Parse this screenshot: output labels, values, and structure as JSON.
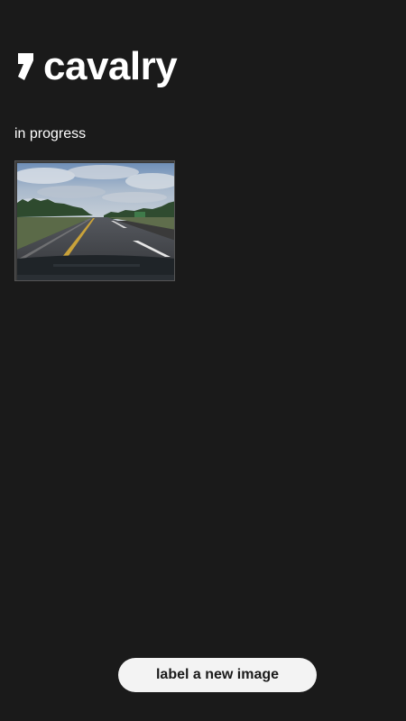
{
  "app": {
    "brand_name": "cavalry",
    "logo_icon": "comma-logo-icon"
  },
  "in_progress": {
    "heading": "in progress",
    "items": [
      {
        "thumbnail": "highway-road-photo"
      }
    ]
  },
  "actions": {
    "new_label_button": "label a new image"
  },
  "colors": {
    "background": "#1a1a1a",
    "text": "#ffffff",
    "button_bg": "#f3f3f3",
    "button_text": "#1a1a1a"
  }
}
